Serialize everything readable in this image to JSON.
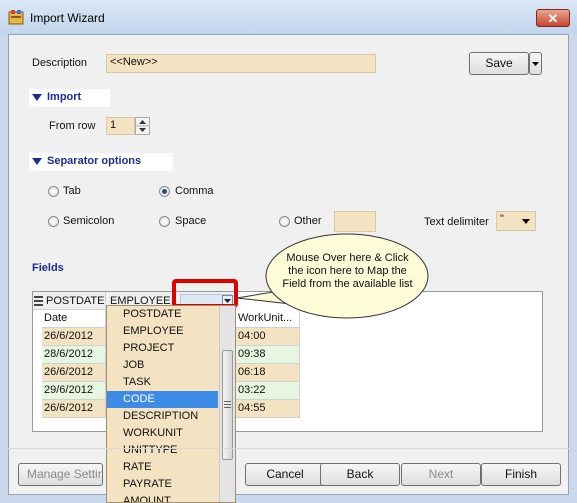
{
  "window": {
    "title": "Import Wizard",
    "close": "✕"
  },
  "description": {
    "label": "Description",
    "value": "<<New>>",
    "save": "Save"
  },
  "import": {
    "heading": "Import",
    "from_row_label": "From row",
    "from_row_value": "1"
  },
  "separator": {
    "heading": "Separator options",
    "tab": "Tab",
    "comma": "Comma",
    "semicolon": "Semicolon",
    "space": "Space",
    "other": "Other",
    "text_delimiter_label": "Text delimiter",
    "text_delimiter_value": "\""
  },
  "fields": {
    "heading": "Fields",
    "col1_header": "POSTDATE",
    "col2_header": "EMPLOYEE",
    "col1_sub": "Date",
    "col3_sub": "WorkUnit...",
    "rows": [
      {
        "date": "26/6/2012",
        "workunit": "04:00"
      },
      {
        "date": "28/6/2012",
        "workunit": "09:38"
      },
      {
        "date": "26/6/2012",
        "workunit": "06:18"
      },
      {
        "date": "29/6/2012",
        "workunit": "03:22"
      },
      {
        "date": "26/6/2012",
        "workunit": "04:55"
      }
    ]
  },
  "dropdown": {
    "items": [
      "POSTDATE",
      "EMPLOYEE",
      "PROJECT",
      "JOB",
      "TASK",
      "CODE",
      "DESCRIPTION",
      "WORKUNIT",
      "UNITTYPE",
      "RATE",
      "PAYRATE",
      "AMOUNT"
    ],
    "selected": "CODE"
  },
  "callout": "Mouse Over here & Click the icon here to Map the Field from the available list",
  "footer": {
    "manage": "Manage Setting",
    "cancel": "Cancel",
    "back": "Back",
    "next": "Next",
    "finish": "Finish"
  },
  "colors": {
    "field_bg": "#f3e3c2",
    "accent": "#1b2e8c",
    "highlight": "#e00000",
    "callout_bg": "#fdfbd8"
  }
}
